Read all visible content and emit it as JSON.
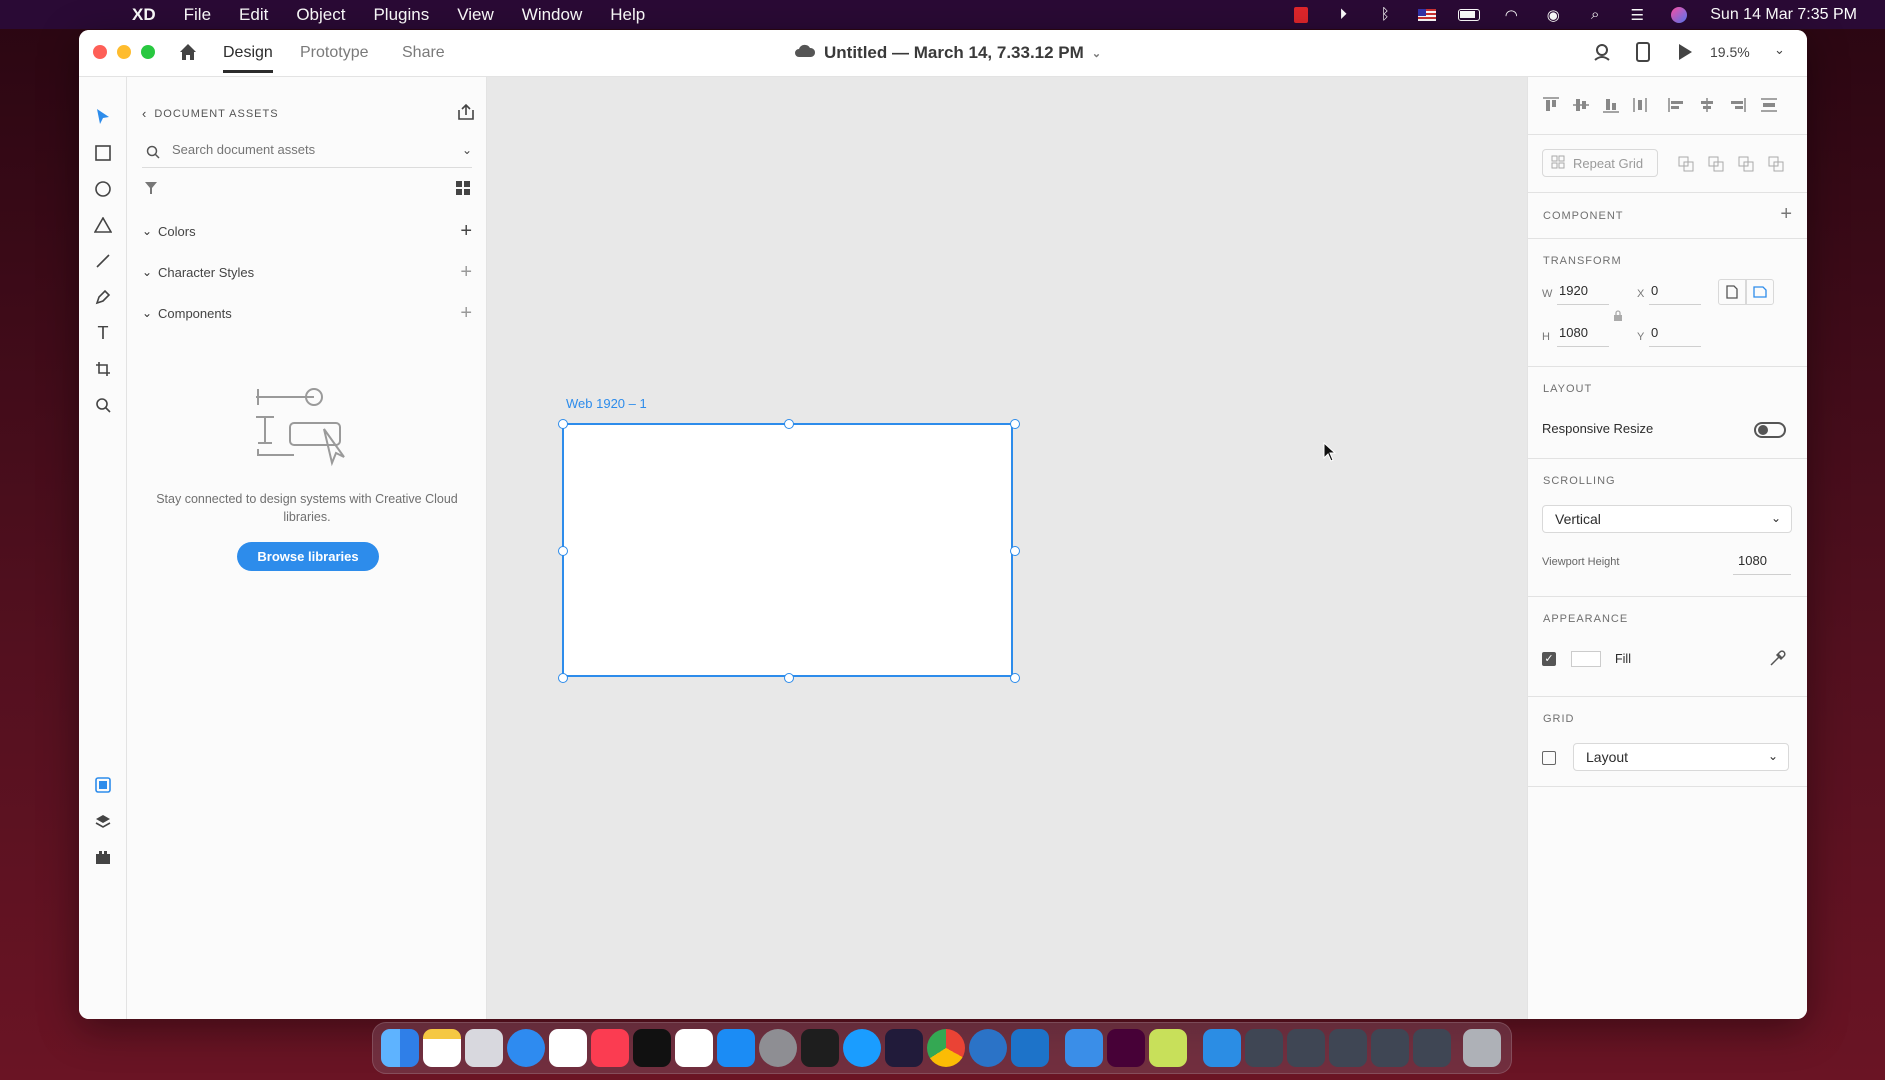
{
  "menubar": {
    "apple": "",
    "app_name": "XD",
    "menus": [
      "File",
      "Edit",
      "Object",
      "Plugins",
      "View",
      "Window",
      "Help"
    ],
    "clock": "Sun 14 Mar  7:35 PM"
  },
  "titlebar": {
    "tabs": [
      "Design",
      "Prototype",
      "Share"
    ],
    "active_tab": "Design",
    "doc_title": "Untitled — March 14, 7.33.12 PM",
    "zoom": "19.5%"
  },
  "assets": {
    "header": "DOCUMENT ASSETS",
    "search_placeholder": "Search document assets",
    "sections": [
      {
        "label": "Colors"
      },
      {
        "label": "Character Styles"
      },
      {
        "label": "Components"
      }
    ],
    "empty_message": "Stay connected to design systems with Creative Cloud libraries.",
    "browse_button": "Browse libraries"
  },
  "canvas": {
    "artboard_name": "Web 1920 – 1"
  },
  "inspector": {
    "repeat_grid": "Repeat Grid",
    "component_label": "COMPONENT",
    "transform_label": "TRANSFORM",
    "w_label": "W",
    "w_value": "1920",
    "h_label": "H",
    "h_value": "1080",
    "x_label": "X",
    "x_value": "0",
    "y_label": "Y",
    "y_value": "0",
    "layout_label": "LAYOUT",
    "responsive_resize": "Responsive Resize",
    "scrolling_label": "SCROLLING",
    "scrolling_value": "Vertical",
    "viewport_height_label": "Viewport Height",
    "viewport_height_value": "1080",
    "appearance_label": "APPEARANCE",
    "fill_label": "Fill",
    "grid_label": "GRID",
    "grid_value": "Layout"
  },
  "colors": {
    "accent": "#2d8ceb",
    "menubar": "#2a0a35",
    "close": "#fe5f57",
    "minimize": "#febc2e",
    "maximize": "#28c840"
  }
}
